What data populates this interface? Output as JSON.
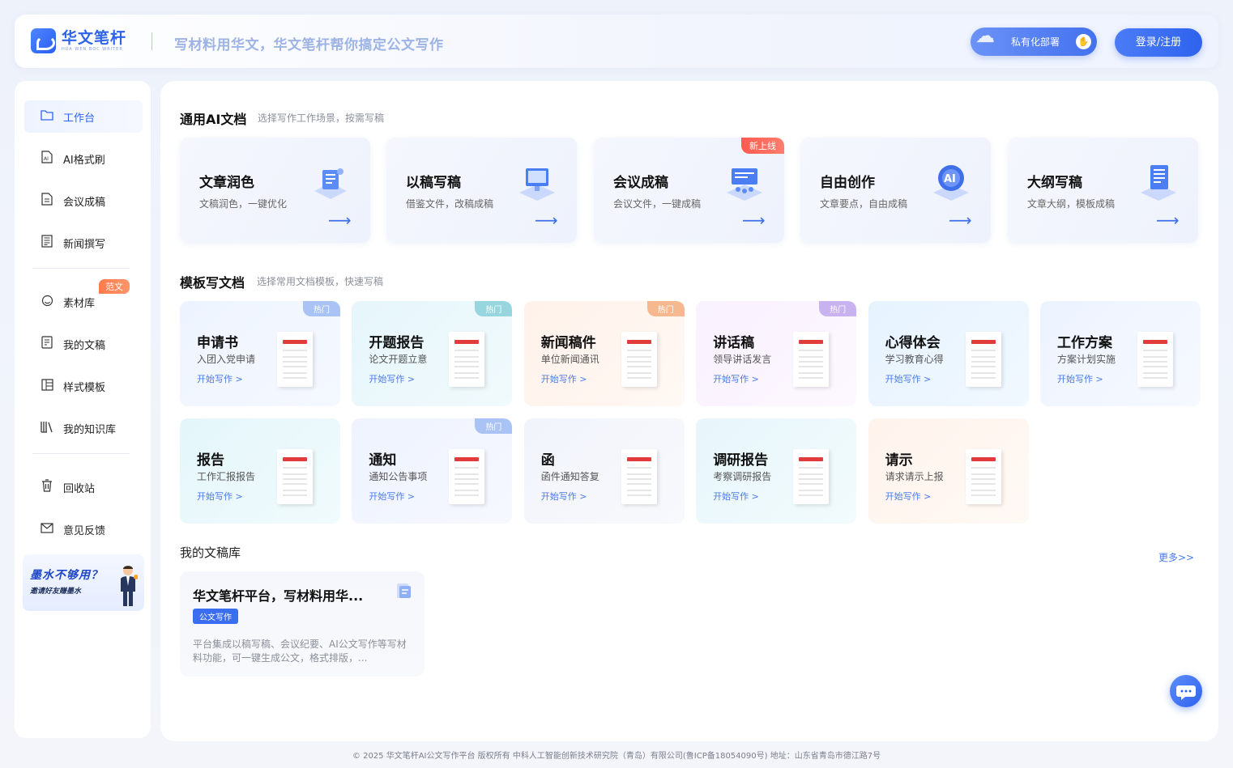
{
  "header": {
    "logo_cn": "华文笔杆",
    "logo_en": "HUA WEN BOC WRITER",
    "slogan": "写材料用华文，华文笔杆帮你搞定公文写作",
    "private_deploy": "私有化部署",
    "login": "登录/注册"
  },
  "sidebar": {
    "items": [
      {
        "label": "工作台",
        "icon": "folder-icon"
      },
      {
        "label": "AI格式刷",
        "icon": "ai-doc-icon"
      },
      {
        "label": "会议成稿",
        "icon": "doc-icon"
      },
      {
        "label": "新闻撰写",
        "icon": "news-icon"
      },
      {
        "label": "素材库",
        "icon": "circle-icon"
      },
      {
        "label": "我的文稿",
        "icon": "file-icon"
      },
      {
        "label": "样式模板",
        "icon": "template-icon"
      },
      {
        "label": "我的知识库",
        "icon": "books-icon"
      },
      {
        "label": "回收站",
        "icon": "trash-icon"
      },
      {
        "label": "意见反馈",
        "icon": "mail-icon"
      }
    ],
    "badge_fanwen": "范文",
    "promo_line1": "墨水不够用？",
    "promo_line2": "邀请好友赚墨水"
  },
  "ai_section": {
    "title": "通用AI文档",
    "subtitle": "选择写作工作场景，按需写稿",
    "cards": [
      {
        "title": "文章润色",
        "desc": "文稿润色，一键优化"
      },
      {
        "title": "以稿写稿",
        "desc": "借鉴文件，改稿成稿"
      },
      {
        "title": "会议成稿",
        "desc": "会议文件，一键成稿",
        "badge": "新上线"
      },
      {
        "title": "自由创作",
        "desc": "文章要点，自由成稿"
      },
      {
        "title": "大纲写稿",
        "desc": "文章大纲，模板成稿"
      }
    ]
  },
  "template_section": {
    "title": "模板写文档",
    "subtitle": "选择常用文档模板，快速写稿",
    "go_label": "开始写作 >",
    "hot_label": "热门",
    "cards": [
      {
        "title": "申请书",
        "desc": "入团入党申请",
        "doc_head": "申请书",
        "hot": true,
        "hot_color": "#a9c3f5"
      },
      {
        "title": "开题报告",
        "desc": "论文开题立意",
        "doc_head": "开题报告",
        "hot": true,
        "hot_color": "#97d6df"
      },
      {
        "title": "新闻稿件",
        "desc": "单位新闻通讯",
        "doc_head": "新闻稿件",
        "hot": true,
        "hot_color": "#f6b88e"
      },
      {
        "title": "讲话稿",
        "desc": "领导讲话发言",
        "doc_head": "领导讲话稿",
        "hot": true,
        "hot_color": "#c8b2ef"
      },
      {
        "title": "心得体会",
        "desc": "学习教育心得",
        "doc_head": "心得体会",
        "hot": false
      },
      {
        "title": "工作方案",
        "desc": "方案计划实施",
        "doc_head": "工作方案",
        "hot": false
      },
      {
        "title": "报告",
        "desc": "工作汇报报告",
        "doc_head": "工作报告",
        "hot": false
      },
      {
        "title": "通知",
        "desc": "通知公告事项",
        "doc_head": "通知公告",
        "hot": true,
        "hot_color": "#a9c3f5"
      },
      {
        "title": "函",
        "desc": "函件通知答复",
        "doc_head": "函文件",
        "hot": false
      },
      {
        "title": "调研报告",
        "desc": "考察调研报告",
        "doc_head": "调研报告",
        "hot": false
      },
      {
        "title": "请示",
        "desc": "请求请示上报",
        "doc_head": "请示公文",
        "hot": false
      }
    ]
  },
  "library": {
    "title": "我的文稿库",
    "more": "更多>>",
    "draft": {
      "title": "华文笔杆平台，写材料用华...",
      "tag": "公文写作",
      "desc": "平台集成以稿写稿、会议纪要、AI公文写作等写材料功能，可一键生成公文，格式排版，..."
    }
  },
  "footer": "© 2025 华文笔杆AI公文写作平台 版权所有 中科人工智能创新技术研究院（青岛）有限公司(鲁ICP备18054090号) 地址：山东省青岛市德江路7号"
}
